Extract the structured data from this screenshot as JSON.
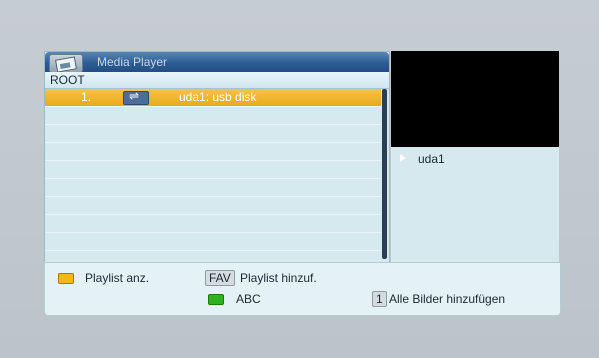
{
  "window": {
    "title": "Media Player"
  },
  "path": "ROOT",
  "list": {
    "rows": [
      {
        "index": "1.",
        "name": "uda1: usb disk",
        "icon": "usb-icon",
        "selected": true
      }
    ]
  },
  "sidebar": {
    "device": "uda1"
  },
  "footer": {
    "yellow_label": "Playlist anz.",
    "fav_key": "FAV",
    "fav_label": "Playlist hinzuf.",
    "green_label": "ABC",
    "one_key": "1",
    "one_label": "Alle Bilder hinzufügen"
  },
  "colors": {
    "selection": "#f0b529",
    "title_bar": "#2d5d95",
    "panel": "#d6e9ef",
    "yellow_key": "#f4b814",
    "green_key": "#2fb21f"
  }
}
